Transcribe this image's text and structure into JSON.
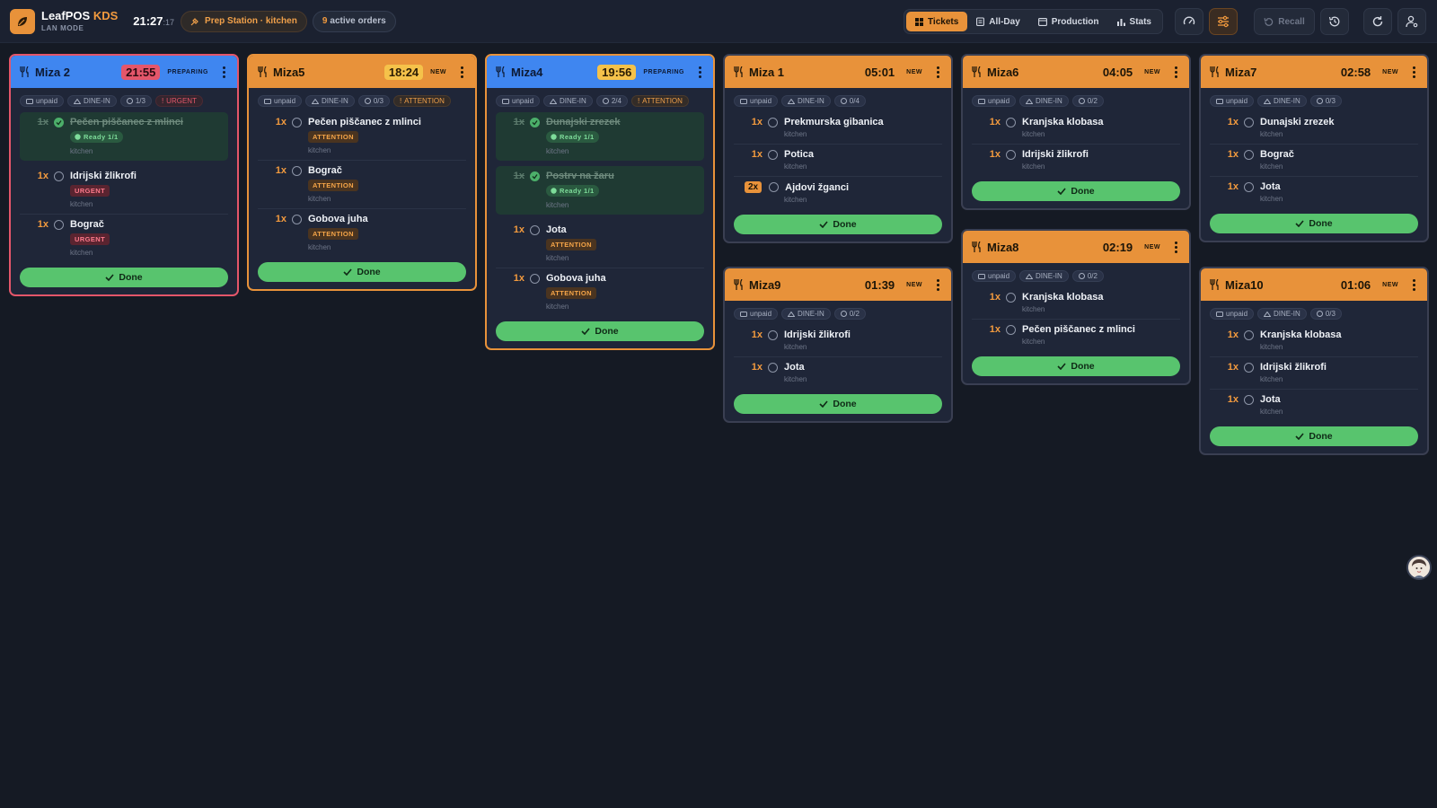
{
  "app": {
    "name": "LeafPOS",
    "name_suffix": "KDS",
    "mode": "LAN MODE",
    "clock_main": "21:27",
    "clock_sec": ":17",
    "station": "Prep Station · kitchen",
    "active_count": "9",
    "active_label": "active orders"
  },
  "nav": {
    "tickets": "Tickets",
    "allday": "All-Day",
    "production": "Production",
    "stats": "Stats",
    "recall": "Recall"
  },
  "colors": {
    "accent": "#e8923a",
    "preparing": "#3f86f0",
    "done": "#58c46e",
    "urgent": "#e4566a"
  },
  "tickets": [
    {
      "name": "Miza 2",
      "timer": "21:55",
      "status": "PREPARING",
      "tags": [
        "unpaid",
        "DINE-IN",
        "1/3",
        "URGENT"
      ],
      "items": [
        {
          "qty": "1x",
          "name": "Pečen piščanec z mlinci",
          "badge": "Ready 1/1",
          "station": "kitchen"
        },
        {
          "qty": "1x",
          "name": "Idrijski žlikrofi",
          "badge": "URGENT",
          "station": "kitchen"
        },
        {
          "qty": "1x",
          "name": "Bograč",
          "badge": "URGENT",
          "station": "kitchen"
        }
      ],
      "done": "Done"
    },
    {
      "name": "Miza5",
      "timer": "18:24",
      "status": "NEW",
      "tags": [
        "unpaid",
        "DINE-IN",
        "0/3",
        "ATTENTION"
      ],
      "items": [
        {
          "qty": "1x",
          "name": "Pečen piščanec z mlinci",
          "badge": "ATTENTION",
          "station": "kitchen"
        },
        {
          "qty": "1x",
          "name": "Bograč",
          "badge": "ATTENTION",
          "station": "kitchen"
        },
        {
          "qty": "1x",
          "name": "Gobova juha",
          "badge": "ATTENTION",
          "station": "kitchen"
        }
      ],
      "done": "Done"
    },
    {
      "name": "Miza4",
      "timer": "19:56",
      "status": "PREPARING",
      "tags": [
        "unpaid",
        "DINE-IN",
        "2/4",
        "ATTENTION"
      ],
      "items": [
        {
          "qty": "1x",
          "name": "Dunajski zrezek",
          "badge": "Ready 1/1",
          "station": "kitchen"
        },
        {
          "qty": "1x",
          "name": "Postrv na žaru",
          "badge": "Ready 1/1",
          "station": "kitchen"
        },
        {
          "qty": "1x",
          "name": "Jota",
          "badge": "ATTENTION",
          "station": "kitchen"
        },
        {
          "qty": "1x",
          "name": "Gobova juha",
          "badge": "ATTENTION",
          "station": "kitchen"
        }
      ],
      "done": "Done"
    },
    {
      "name": "Miza 1",
      "timer": "05:01",
      "status": "NEW",
      "tags": [
        "unpaid",
        "DINE-IN",
        "0/4"
      ],
      "items": [
        {
          "qty": "1x",
          "name": "Prekmurska gibanica",
          "station": "kitchen"
        },
        {
          "qty": "1x",
          "name": "Potica",
          "station": "kitchen"
        },
        {
          "qty": "2x",
          "name": "Ajdovi žganci",
          "station": "kitchen"
        }
      ],
      "done": "Done"
    },
    {
      "name": "Miza6",
      "timer": "04:05",
      "status": "NEW",
      "tags": [
        "unpaid",
        "DINE-IN",
        "0/2"
      ],
      "items": [
        {
          "qty": "1x",
          "name": "Kranjska klobasa",
          "station": "kitchen"
        },
        {
          "qty": "1x",
          "name": "Idrijski žlikrofi",
          "station": "kitchen"
        }
      ],
      "done": "Done"
    },
    {
      "name": "Miza7",
      "timer": "02:58",
      "status": "NEW",
      "tags": [
        "unpaid",
        "DINE-IN",
        "0/3"
      ],
      "items": [
        {
          "qty": "1x",
          "name": "Dunajski zrezek",
          "station": "kitchen"
        },
        {
          "qty": "1x",
          "name": "Bograč",
          "station": "kitchen"
        },
        {
          "qty": "1x",
          "name": "Jota",
          "station": "kitchen"
        }
      ],
      "done": "Done"
    },
    {
      "name": "Miza9",
      "timer": "01:39",
      "status": "NEW",
      "tags": [
        "unpaid",
        "DINE-IN",
        "0/2"
      ],
      "items": [
        {
          "qty": "1x",
          "name": "Idrijski žlikrofi",
          "station": "kitchen"
        },
        {
          "qty": "1x",
          "name": "Jota",
          "station": "kitchen"
        }
      ],
      "done": "Done"
    },
    {
      "name": "Miza8",
      "timer": "02:19",
      "status": "NEW",
      "tags": [
        "unpaid",
        "DINE-IN",
        "0/2"
      ],
      "items": [
        {
          "qty": "1x",
          "name": "Kranjska klobasa",
          "station": "kitchen"
        },
        {
          "qty": "1x",
          "name": "Pečen piščanec z mlinci",
          "station": "kitchen"
        }
      ],
      "done": "Done"
    },
    {
      "name": "Miza10",
      "timer": "01:06",
      "status": "NEW",
      "tags": [
        "unpaid",
        "DINE-IN",
        "0/3"
      ],
      "items": [
        {
          "qty": "1x",
          "name": "Kranjska klobasa",
          "station": "kitchen"
        },
        {
          "qty": "1x",
          "name": "Idrijski žlikrofi",
          "station": "kitchen"
        },
        {
          "qty": "1x",
          "name": "Jota",
          "station": "kitchen"
        }
      ],
      "done": "Done"
    }
  ]
}
